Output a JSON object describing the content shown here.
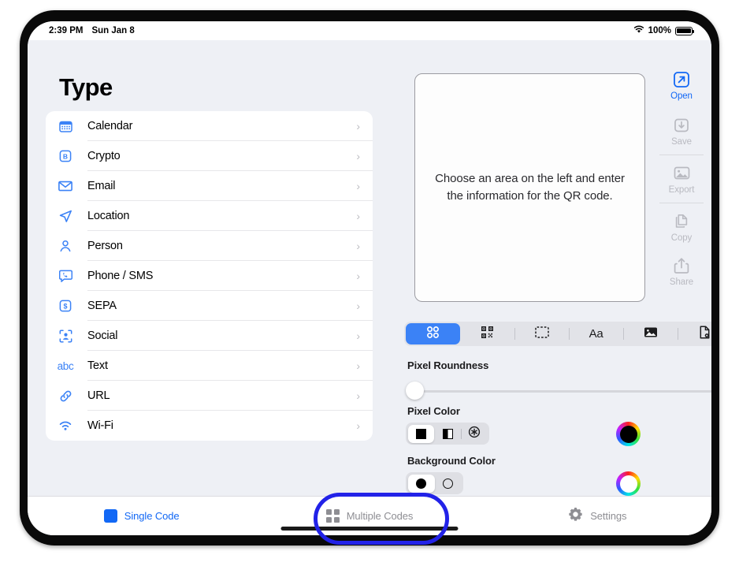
{
  "status_bar": {
    "time": "2:39 PM",
    "date": "Sun Jan 8",
    "wifi_icon": "wifi-icon",
    "battery_percent": "100%",
    "battery_icon": "battery-full-icon"
  },
  "left_panel": {
    "title": "Type",
    "items": [
      {
        "label": "Calendar",
        "icon": "calendar-icon",
        "chevron": "›"
      },
      {
        "label": "Crypto",
        "icon": "bitcoin-icon",
        "chevron": "›"
      },
      {
        "label": "Email",
        "icon": "envelope-icon",
        "chevron": "›"
      },
      {
        "label": "Location",
        "icon": "paper-plane-icon",
        "chevron": "›"
      },
      {
        "label": "Person",
        "icon": "person-icon",
        "chevron": "›"
      },
      {
        "label": "Phone / SMS",
        "icon": "phone-bubble-icon",
        "chevron": "›"
      },
      {
        "label": "SEPA",
        "icon": "dollar-square-icon",
        "chevron": "›"
      },
      {
        "label": "Social",
        "icon": "person-viewfinder-icon",
        "chevron": "›"
      },
      {
        "label": "Text",
        "icon": "abc-icon",
        "chevron": "›",
        "icon_text": "abc"
      },
      {
        "label": "URL",
        "icon": "link-icon",
        "chevron": "›"
      },
      {
        "label": "Wi-Fi",
        "icon": "wifi-icon",
        "chevron": "›"
      }
    ]
  },
  "preview": {
    "placeholder": "Choose an area on the left and enter the information for the QR code."
  },
  "style_tabs": {
    "items": [
      {
        "name": "pixel-shape-tab",
        "icon": "four-dots-icon",
        "selected": true
      },
      {
        "name": "qr-pattern-tab",
        "icon": "qr-code-icon",
        "selected": false
      },
      {
        "name": "frame-tab",
        "icon": "dashed-frame-icon",
        "selected": false
      },
      {
        "name": "text-tab",
        "icon": "aa-icon",
        "selected": false,
        "glyph": "Aa"
      },
      {
        "name": "image-tab",
        "icon": "photo-icon",
        "selected": false
      },
      {
        "name": "file-settings-tab",
        "icon": "file-gear-icon",
        "selected": false
      }
    ]
  },
  "controls": {
    "pixel_roundness": {
      "label": "Pixel Roundness",
      "value": 0
    },
    "pixel_color": {
      "label": "Pixel Color",
      "options": [
        {
          "name": "solid-square-option",
          "selected": true
        },
        {
          "name": "half-square-option",
          "selected": false
        },
        {
          "name": "asterisk-option",
          "selected": false
        }
      ],
      "wheel_color": "#000000"
    },
    "background_color": {
      "label": "Background Color",
      "options": [
        {
          "name": "filled-circle-option",
          "selected": true
        },
        {
          "name": "outline-circle-option",
          "selected": false
        }
      ],
      "wheel_color": "#ffffff"
    }
  },
  "action_sidebar": {
    "items": [
      {
        "label": "Open",
        "icon": "open-arrow-icon",
        "enabled": true
      },
      {
        "label": "Save",
        "icon": "save-download-icon",
        "enabled": false
      },
      {
        "label": "Export",
        "icon": "photo-export-icon",
        "enabled": false
      },
      {
        "label": "Copy",
        "icon": "copy-documents-icon",
        "enabled": false
      },
      {
        "label": "Share",
        "icon": "share-icon",
        "enabled": false
      }
    ]
  },
  "tab_bar": {
    "tabs": [
      {
        "label": "Single Code",
        "icon": "blue-square-icon",
        "active": true
      },
      {
        "label": "Multiple Codes",
        "icon": "four-squares-icon",
        "active": false,
        "highlighted": true
      },
      {
        "label": "Settings",
        "icon": "gear-icon",
        "active": false
      }
    ]
  },
  "annotation": {
    "color": "#2222e8",
    "target": "Multiple Codes"
  }
}
